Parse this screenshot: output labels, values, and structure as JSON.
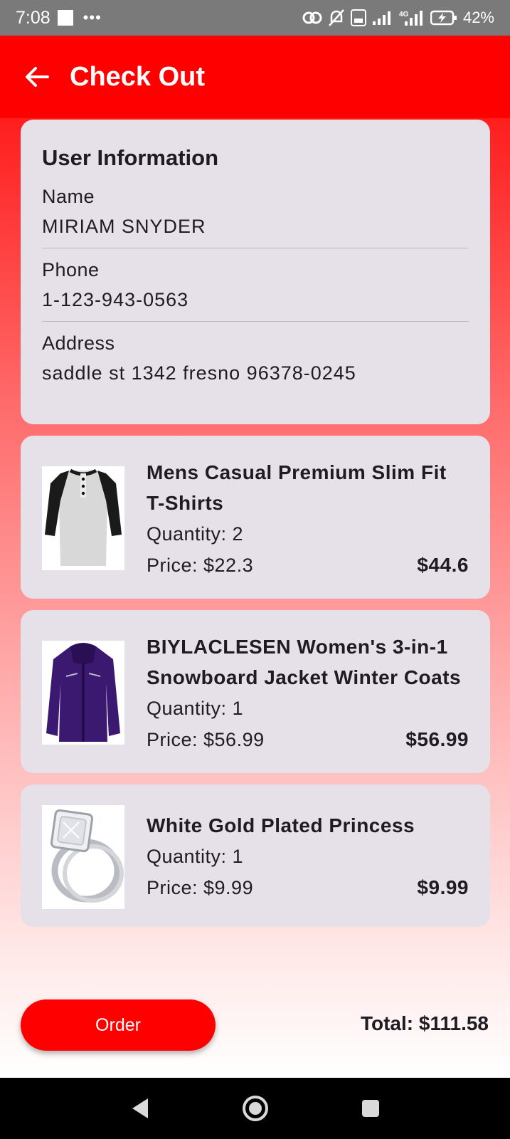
{
  "status_bar": {
    "time": "7:08",
    "battery_percent": "42%",
    "icons": [
      "notification-square-icon",
      "more-dots-icon",
      "hotspot-icon",
      "bell-off-icon",
      "volte-icon",
      "signal-icon",
      "4g-signal-icon",
      "battery-charging-icon"
    ]
  },
  "app_bar": {
    "title": "Check Out",
    "back_icon": "arrow-left-icon",
    "background_color": "#ff0000"
  },
  "user_info": {
    "title": "User Information",
    "name_label": "Name",
    "name_value": "MIRIAM SNYDER",
    "phone_label": "Phone",
    "phone_value": "1-123-943-0563",
    "address_label": "Address",
    "address_value": "saddle st 1342 fresno 96378-0245"
  },
  "cart_items": [
    {
      "name_line1": "Mens Casual Premium Slim Fit",
      "name_line2": "T-Shirts",
      "quantity": "Quantity: 2",
      "price": "Price: $22.3",
      "total": "$44.6",
      "image_icon": "tshirt-image"
    },
    {
      "name_line1": "BIYLACLESEN Women's 3-in-1",
      "name_line2": "Snowboard Jacket Winter Coats",
      "quantity": "Quantity: 1",
      "price": "Price: $56.99",
      "total": "$56.99",
      "image_icon": "jacket-image"
    },
    {
      "name_line1": "White Gold Plated Princess",
      "quantity": "Quantity: 1",
      "price": "Price: $9.99",
      "total": "$9.99",
      "image_icon": "ring-image"
    }
  ],
  "footer": {
    "order_label": "Order",
    "total_label": "Total: $111.58"
  },
  "nav_bar": {
    "icons": [
      "nav-back-icon",
      "nav-home-icon",
      "nav-recents-icon"
    ]
  },
  "colors": {
    "accent": "#ff0000",
    "card": "#e6e0e8",
    "text": "#1f1b22"
  }
}
